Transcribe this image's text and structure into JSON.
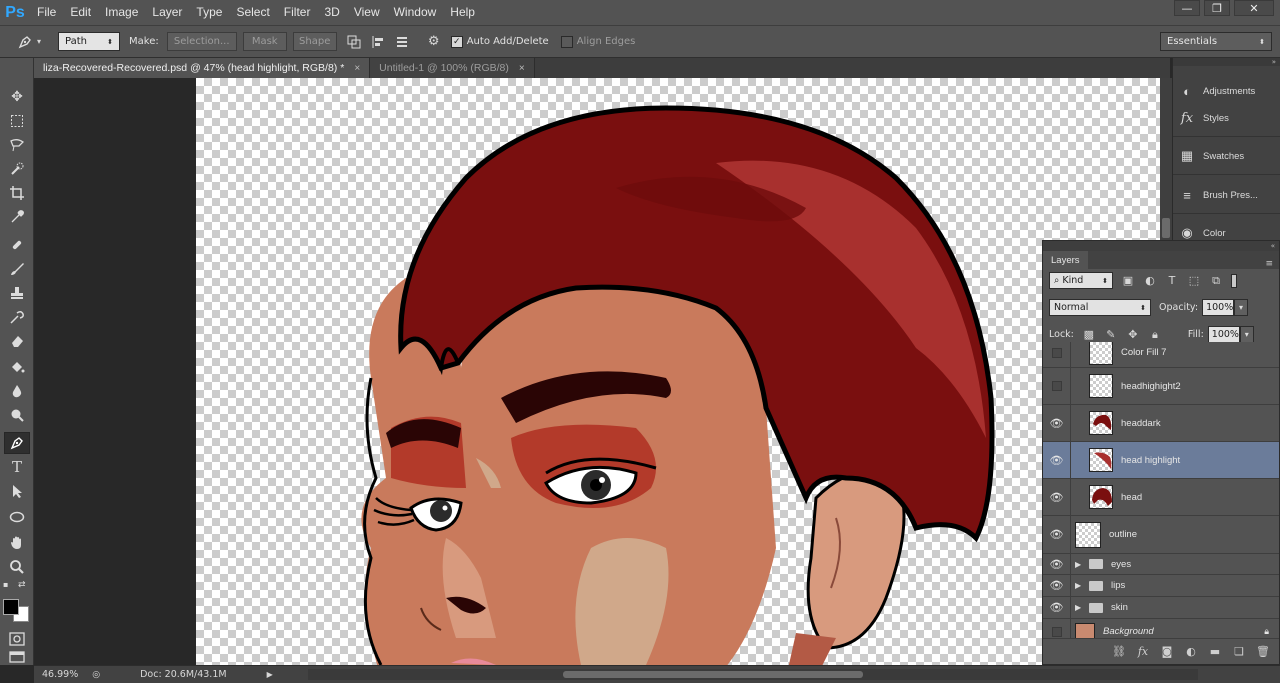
{
  "app": {
    "logo": "Ps"
  },
  "menu": [
    "File",
    "Edit",
    "Image",
    "Layer",
    "Type",
    "Select",
    "Filter",
    "3D",
    "View",
    "Window",
    "Help"
  ],
  "window_controls": {
    "minimize": "—",
    "restore": "❐",
    "close": "✕"
  },
  "options_bar": {
    "tool_icon": "pen-tool-icon",
    "mode_value": "Path",
    "make_label": "Make:",
    "selection_label": "Selection...",
    "mask_label": "Mask",
    "shape_label": "Shape",
    "auto_add_delete": {
      "label": "Auto Add/Delete",
      "checked": true
    },
    "align_edges": {
      "label": "Align Edges",
      "checked": false
    },
    "workspace_value": "Essentials"
  },
  "tabs": [
    {
      "label": "liza-Recovered-Recovered.psd @ 47% (head highlight, RGB/8) *",
      "active": true
    },
    {
      "label": "Untitled-1 @ 100% (RGB/8)",
      "active": false
    }
  ],
  "tab_close": "×",
  "tools": [
    "move-tool-icon",
    "marquee-tool-icon",
    "lasso-tool-icon",
    "quick-selection-tool-icon",
    "crop-tool-icon",
    "eyedropper-tool-icon",
    "healing-brush-tool-icon",
    "brush-tool-icon",
    "clone-stamp-tool-icon",
    "history-brush-tool-icon",
    "eraser-tool-icon",
    "paint-bucket-tool-icon",
    "blur-tool-icon",
    "dodge-tool-icon",
    "pen-tool-icon",
    "type-tool-icon",
    "path-selection-tool-icon",
    "ellipse-tool-icon",
    "hand-tool-icon",
    "zoom-tool-icon"
  ],
  "colors": {
    "foreground": "#000000",
    "background": "#ffffff",
    "hair": "#7a0f0f",
    "hair_dark": "#5c0707",
    "hair_highlight": "#a8302e",
    "skin": "#c97a5c",
    "skin_light": "#d89a7e",
    "skin_shadow": "#b35a45",
    "outline": "#000000"
  },
  "right_dock": [
    {
      "label": "Adjustments",
      "icon": "adjustments-icon"
    },
    {
      "label": "Styles",
      "icon": "styles-icon"
    },
    {
      "label": "Swatches",
      "icon": "swatches-icon"
    },
    {
      "label": "Brush Pres...",
      "icon": "brush-presets-icon"
    },
    {
      "label": "Color",
      "icon": "color-icon"
    }
  ],
  "layers_panel": {
    "tab_label": "Layers",
    "filter_kind": "Kind",
    "blend_mode": "Normal",
    "opacity_label": "Opacity:",
    "opacity_value": "100%",
    "lock_label": "Lock:",
    "fill_label": "Fill:",
    "fill_value": "100%",
    "layers": [
      {
        "name": "Color Fill 7",
        "visible": false,
        "type": "fill"
      },
      {
        "name": "headhighight2",
        "visible": false,
        "type": "shape"
      },
      {
        "name": "headdark",
        "visible": true,
        "type": "shape"
      },
      {
        "name": "head highlight",
        "visible": true,
        "type": "shape",
        "selected": true
      },
      {
        "name": "head",
        "visible": true,
        "type": "shape"
      },
      {
        "name": "outline",
        "visible": true,
        "type": "pixel"
      },
      {
        "name": "eyes",
        "visible": true,
        "type": "group"
      },
      {
        "name": "lips",
        "visible": true,
        "type": "group"
      },
      {
        "name": "skin",
        "visible": true,
        "type": "group"
      },
      {
        "name": "Background",
        "visible": false,
        "type": "background"
      }
    ]
  },
  "status_bar": {
    "zoom": "46.99%",
    "doc_size": "Doc: 20.6M/43.1M"
  }
}
